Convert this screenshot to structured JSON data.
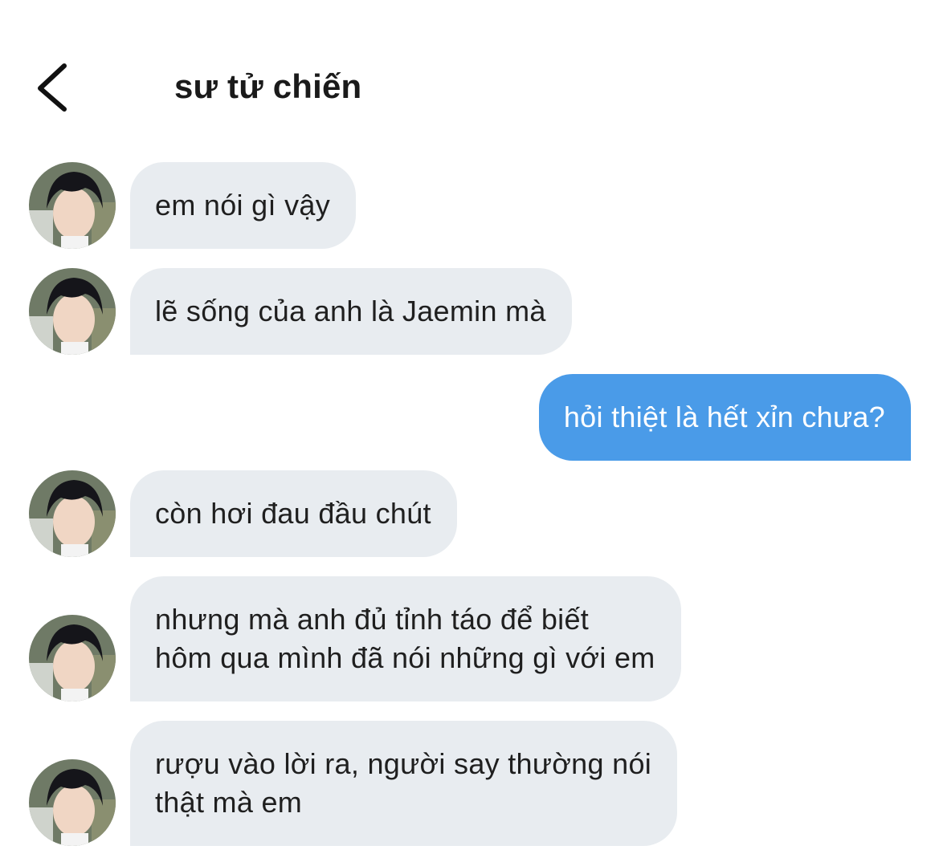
{
  "header": {
    "title": "sư tử chiến",
    "back_icon": "chevron-left-icon"
  },
  "messages": [
    {
      "direction": "incoming",
      "text": "em nói gì vậy"
    },
    {
      "direction": "incoming",
      "text": "lẽ sống của anh là Jaemin mà"
    },
    {
      "direction": "outgoing",
      "text": "hỏi thiệt là hết xỉn chưa?"
    },
    {
      "direction": "incoming",
      "text": "còn hơi đau đầu chút"
    },
    {
      "direction": "incoming",
      "text": "nhưng mà anh đủ tỉnh táo để biết\nhôm qua mình đã nói những gì với em"
    },
    {
      "direction": "incoming",
      "text": "rượu vào lời ra, người say thường nói\nthật mà em"
    }
  ],
  "colors": {
    "incoming_bubble": "#e8ecf0",
    "outgoing_bubble": "#4a9be8",
    "title_text": "#1a1a1a"
  }
}
